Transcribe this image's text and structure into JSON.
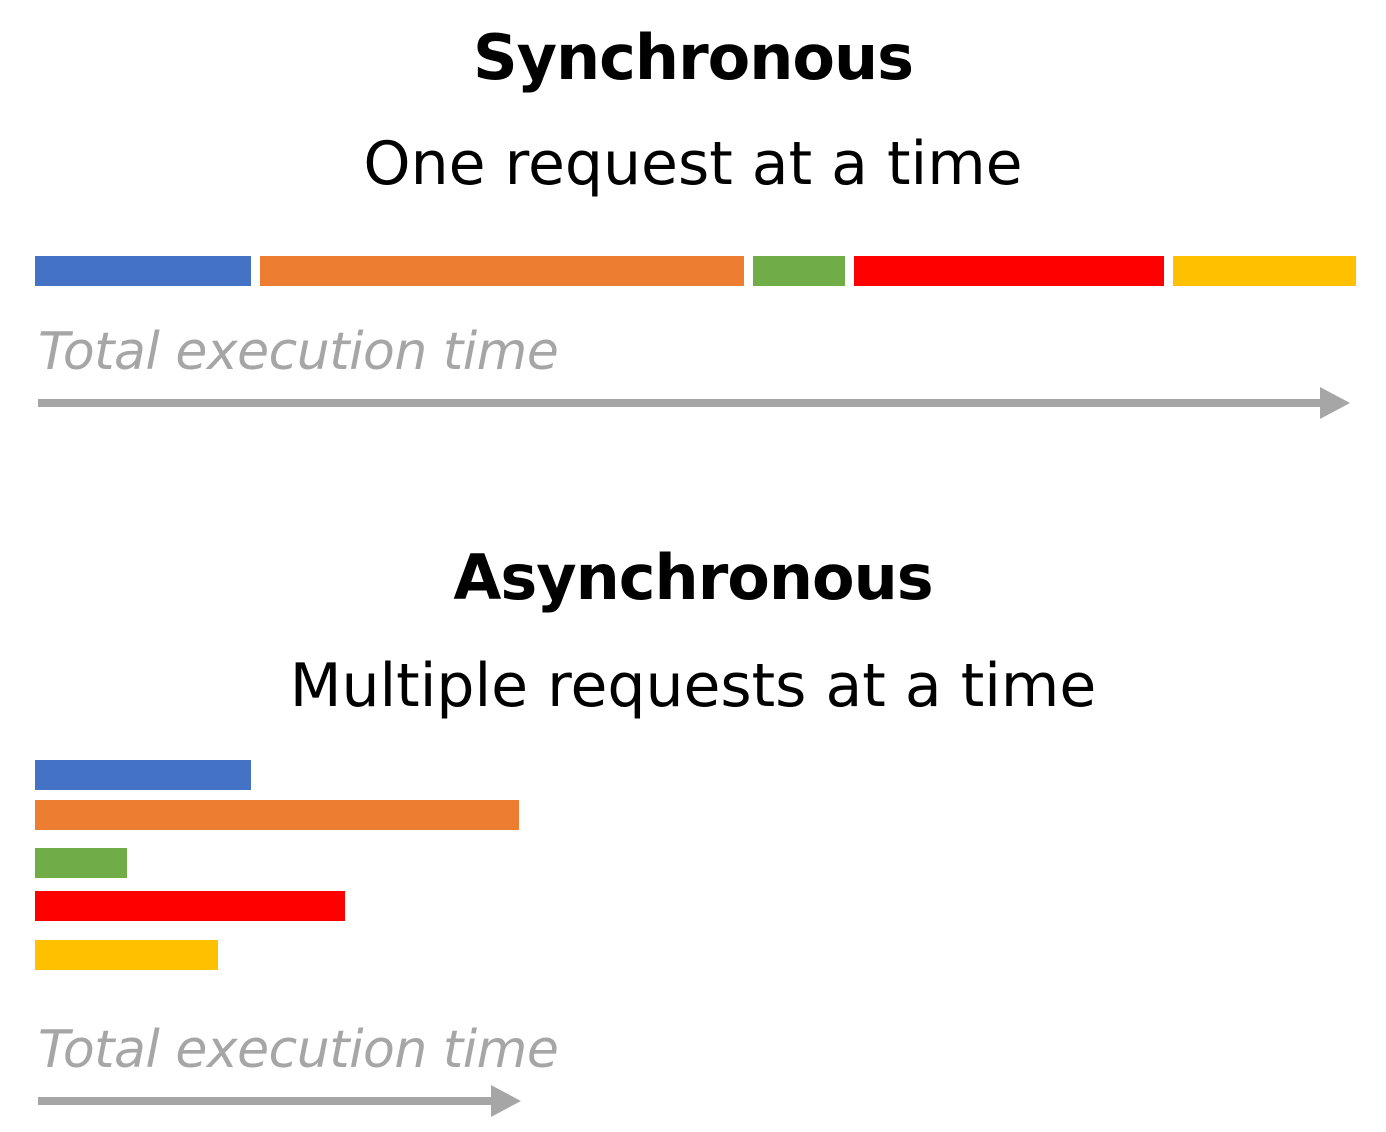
{
  "synchronous": {
    "title": "Synchronous",
    "subtitle": "One request at a time",
    "time_label": "Total execution time",
    "requests": [
      {
        "color": "#4472c4",
        "duration": 216
      },
      {
        "color": "#ed7d31",
        "duration": 484
      },
      {
        "color": "#70ad47",
        "duration": 92
      },
      {
        "color": "#ff0000",
        "duration": 310
      },
      {
        "color": "#ffc000",
        "duration": 183
      }
    ],
    "total_time": 1315
  },
  "asynchronous": {
    "title": "Asynchronous",
    "subtitle": "Multiple requests at a time",
    "time_label": "Total execution time",
    "requests": [
      {
        "color": "#4472c4",
        "duration": 216
      },
      {
        "color": "#ed7d31",
        "duration": 484
      },
      {
        "color": "#70ad47",
        "duration": 92
      },
      {
        "color": "#ff0000",
        "duration": 310
      },
      {
        "color": "#ffc000",
        "duration": 183
      }
    ],
    "total_time": 484
  },
  "colors": {
    "arrow": "#a6a6a6",
    "text": "#000000"
  }
}
